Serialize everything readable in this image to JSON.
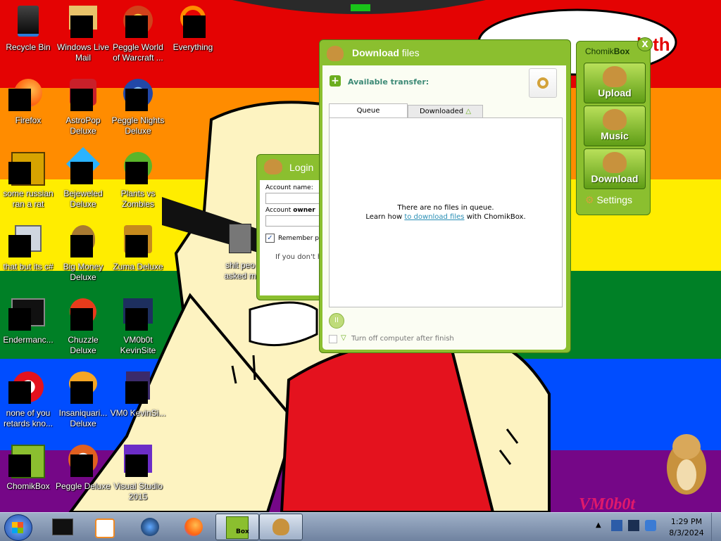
{
  "desktop_icons": [
    {
      "label": "Recycle Bin"
    },
    {
      "label": "Windows Live Mail"
    },
    {
      "label": "Peggle World of Warcraft ..."
    },
    {
      "label": "Everything"
    },
    {
      "label": "Firefox"
    },
    {
      "label": "AstroPop Deluxe"
    },
    {
      "label": "Peggle Nights Deluxe"
    },
    {
      "label": "some russian ran a rat"
    },
    {
      "label": "Bejeweled Deluxe"
    },
    {
      "label": "Plants vs Zombies"
    },
    {
      "label": "that but its c#"
    },
    {
      "label": "Big Money Deluxe"
    },
    {
      "label": "Zuma Deluxe"
    },
    {
      "label": "Endermanc..."
    },
    {
      "label": "Chuzzle Deluxe"
    },
    {
      "label": "VM0b0t KevinSite"
    },
    {
      "label": "none of you retards kno..."
    },
    {
      "label": "Insaniquari... Deluxe"
    },
    {
      "label": "VM0 KevinSi..."
    },
    {
      "label": "ChomikBox"
    },
    {
      "label": "Peggle Deluxe"
    },
    {
      "label": "Visual Studio 2015"
    },
    {
      "label": "shit peo asked m"
    }
  ],
  "speech_text": "h th",
  "login": {
    "title": "Login",
    "account_name_label": "Account name:",
    "account_owner_label_a": "Account ",
    "account_owner_label_b": "owner",
    "remember_label": "Remember p",
    "footer": "If you don't h"
  },
  "download": {
    "title_bold": "Download",
    "title_rest": " files",
    "available": "Available transfer:",
    "tab_queue": "Queue",
    "tab_downloaded": "Downloaded",
    "empty_line1": "There are no files in queue.",
    "empty_prefix": "Learn how ",
    "empty_link": "to download files",
    "empty_suffix": " with ChomikBox.",
    "turnoff": "Turn off computer after finish"
  },
  "chomikbox": {
    "title_a": "Chomik",
    "title_b": "Box",
    "close": "X",
    "upload": "Upload",
    "music": "Music",
    "download": "Download",
    "settings": "Settings"
  },
  "watermark": "VM0b0t",
  "taskbar": {
    "time": "1:29 PM",
    "date": "8/3/2024",
    "items": [
      "terminal",
      "media-player",
      "waterfox",
      "firefox",
      "chomikbox",
      "chomikbox-download"
    ],
    "box_label": "Box"
  },
  "colors": {
    "red": "#e40303",
    "orange": "#ff8c00",
    "yellow": "#ffed00",
    "green": "#008026",
    "blue": "#004dff",
    "purple": "#750787",
    "chomik_green": "#8bbf2f",
    "skin": "#fdf3c1"
  }
}
